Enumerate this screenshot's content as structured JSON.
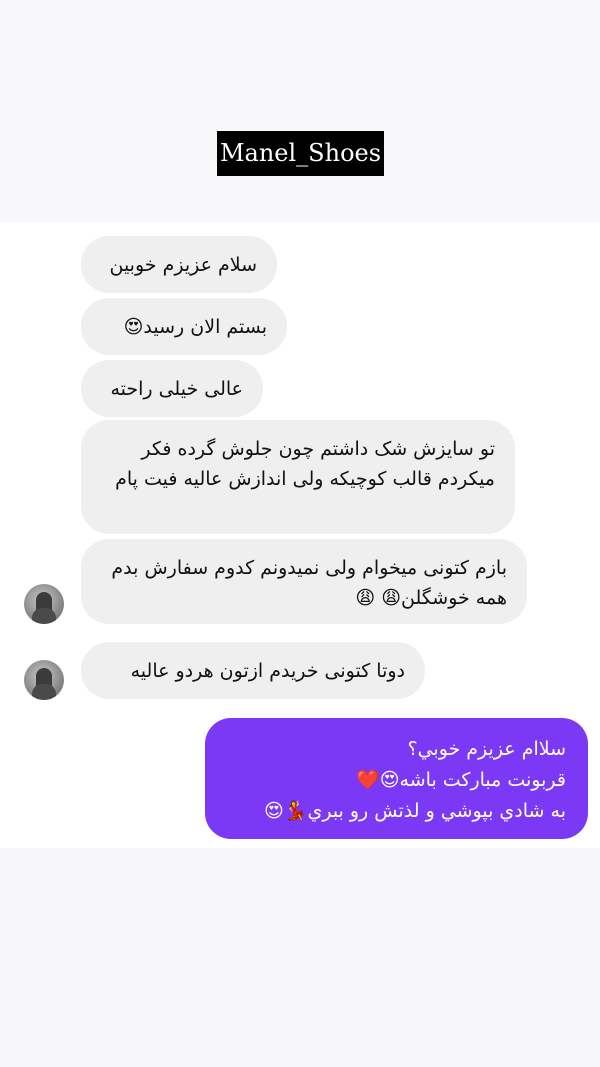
{
  "header": {
    "title": "Manel_Shoes"
  },
  "messages": [
    {
      "sender": "them",
      "text": "سلام عزیزم خوبین"
    },
    {
      "sender": "them",
      "text": "بستم الان رسید😍"
    },
    {
      "sender": "them",
      "text": "عالی خیلی راحته"
    },
    {
      "sender": "them",
      "text": "تو سایزش شک داشتم چون جلوش گرده فکر میکردم قالب کوچیکه ولی اندازش عالیه فیت پام"
    },
    {
      "sender": "them",
      "text": "بازم کتونی میخوام ولی نمیدونم کدوم سفارش بدم همه خوشگلن😩 😩"
    },
    {
      "sender": "them",
      "text": "دوتا کتونی خریدم ازتون هردو عالیه"
    },
    {
      "sender": "me",
      "text": "سلاام عزیزم خوبي؟\nقربونت مبارکت باشه😍❤️\nبه شادي بپوشي و لذتش رو ببري💃😍"
    }
  ],
  "colors": {
    "incoming_bubble": "#efefef",
    "outgoing_bubble": "#7b38f5",
    "title_bg": "#000000"
  }
}
